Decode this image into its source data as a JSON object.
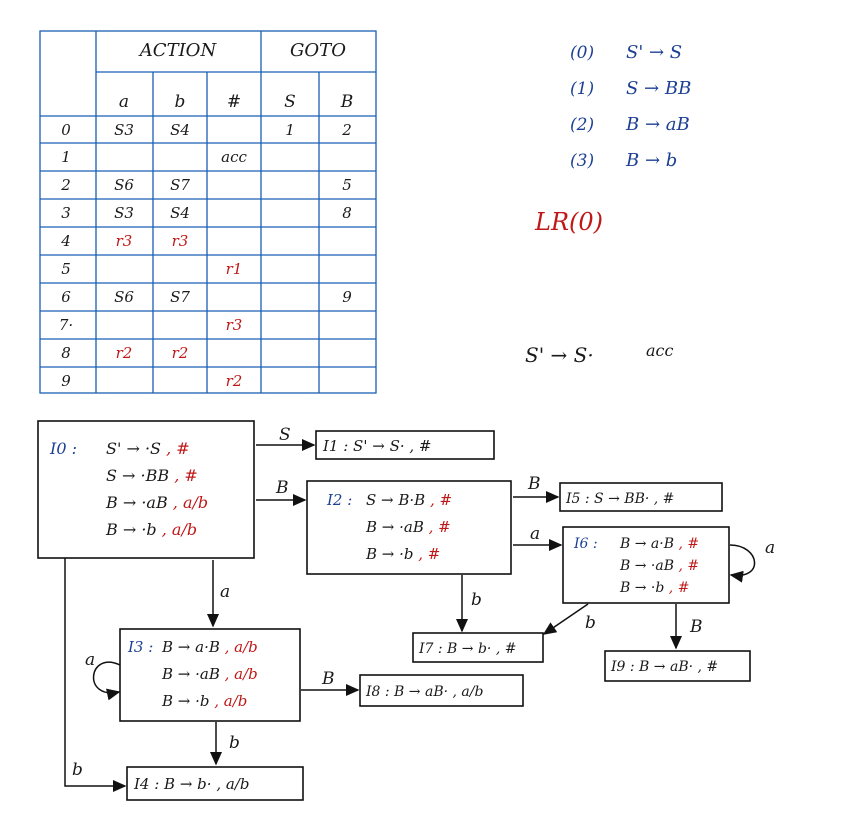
{
  "table": {
    "headers": {
      "action": "ACTION",
      "goto": "GOTO"
    },
    "columns": [
      "a",
      "b",
      "#",
      "S",
      "B"
    ],
    "rows": [
      {
        "state": "0",
        "cells": [
          "S3",
          "S4",
          "",
          "1",
          "2"
        ]
      },
      {
        "state": "1",
        "cells": [
          "",
          "",
          "acc",
          "",
          ""
        ]
      },
      {
        "state": "2",
        "cells": [
          "S6",
          "S7",
          "",
          "",
          "5"
        ]
      },
      {
        "state": "3",
        "cells": [
          "S3",
          "S4",
          "",
          "",
          "8"
        ]
      },
      {
        "state": "4",
        "cells": [
          "r3",
          "r3",
          "",
          "",
          ""
        ]
      },
      {
        "state": "5",
        "cells": [
          "",
          "",
          "r1",
          "",
          ""
        ]
      },
      {
        "state": "6",
        "cells": [
          "S6",
          "S7",
          "",
          "",
          "9"
        ]
      },
      {
        "state": "7·",
        "cells": [
          "",
          "",
          "r3",
          "",
          ""
        ]
      },
      {
        "state": "8",
        "cells": [
          "r2",
          "r2",
          "",
          "",
          ""
        ]
      },
      {
        "state": "9",
        "cells": [
          "",
          "",
          "r2",
          "",
          ""
        ]
      }
    ]
  },
  "grammar": [
    {
      "num": "(0)",
      "rule": "S' → S"
    },
    {
      "num": "(1)",
      "rule": "S → BB"
    },
    {
      "num": "(2)",
      "rule": "B → aB"
    },
    {
      "num": "(3)",
      "rule": "B → b"
    }
  ],
  "lr_label": "LR(0)",
  "accept_note": {
    "item": "S' → S·",
    "text": "acc"
  },
  "states": {
    "I0": {
      "label": "I0 :",
      "items": [
        {
          "core": "S' → ·S",
          "la": ", #"
        },
        {
          "core": "S → ·BB",
          "la": ", #"
        },
        {
          "core": "B → ·aB",
          "la": ", a/b"
        },
        {
          "core": "B → ·b",
          "la": ", a/b"
        }
      ]
    },
    "I1": {
      "text": "I1 : S' → S· , #"
    },
    "I2": {
      "label": "I2 :",
      "items": [
        {
          "core": "S → B·B",
          "la": ", #"
        },
        {
          "core": "B → ·aB",
          "la": ", #"
        },
        {
          "core": "B → ·b",
          "la": ", #"
        }
      ]
    },
    "I3": {
      "label": "I3 :",
      "items": [
        {
          "core": "B → a·B",
          "la": ", a/b"
        },
        {
          "core": "B → ·aB",
          "la": ", a/b"
        },
        {
          "core": "B → ·b",
          "la": ", a/b"
        }
      ]
    },
    "I4": {
      "text": "I4 : B → b· , a/b"
    },
    "I5": {
      "text": "I5 : S → BB· , #"
    },
    "I6": {
      "label": "I6 :",
      "items": [
        {
          "core": "B → a·B",
          "la": ", #"
        },
        {
          "core": "B → ·aB",
          "la": ", #"
        },
        {
          "core": "B → ·b",
          "la": ", #"
        }
      ]
    },
    "I7": {
      "text": "I7 : B → b· , #"
    },
    "I8": {
      "text": "I8 : B → aB· , a/b"
    },
    "I9": {
      "text": "I9 : B → aB· , #"
    }
  },
  "transitions": {
    "i0_i1": "S",
    "i0_i2": "B",
    "i0_i3": "a",
    "i0_i4": "b",
    "i2_i5": "B",
    "i2_i6": "a",
    "i2_i7": "b",
    "i3_i3": "a",
    "i3_i8": "B",
    "i3_i4": "b",
    "i6_i6": "a",
    "i6_i7": "b",
    "i6_i9": "B"
  }
}
